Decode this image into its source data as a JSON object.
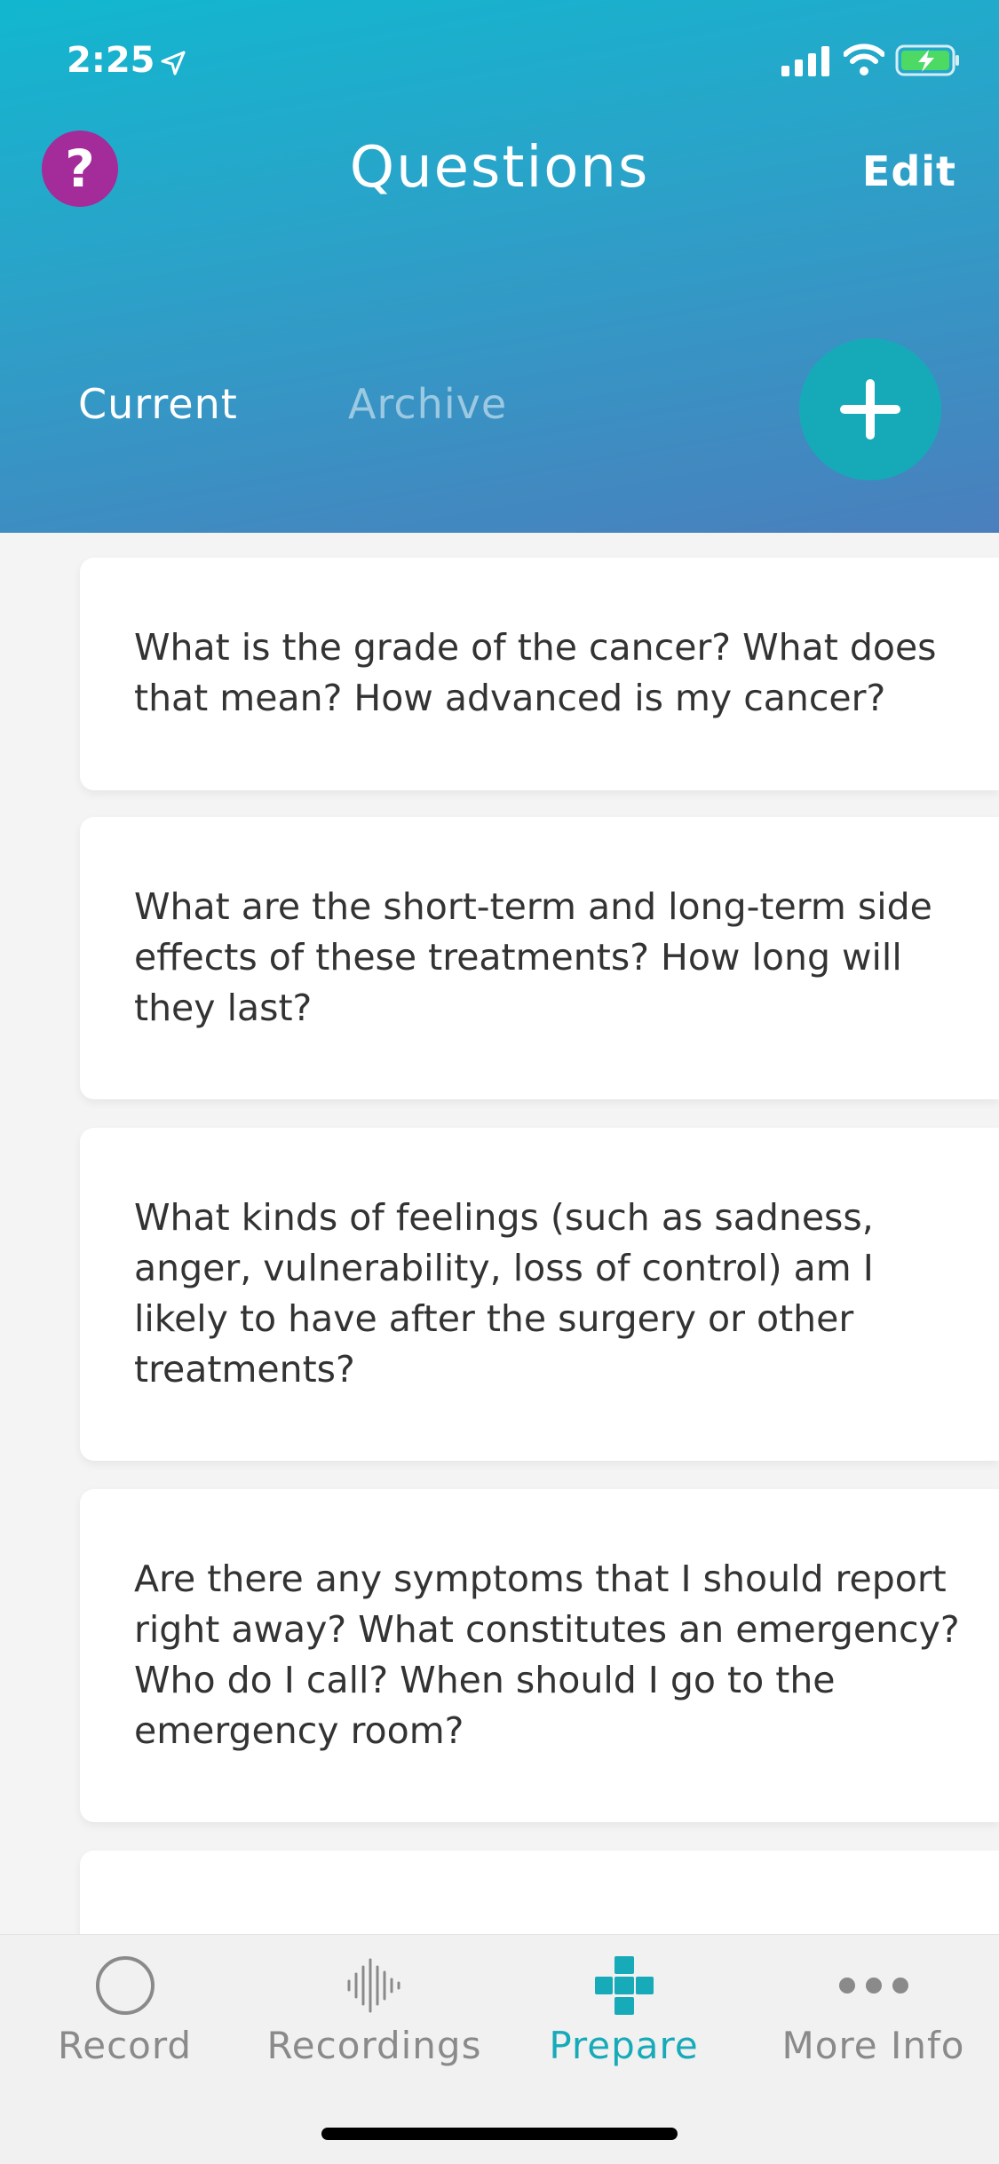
{
  "status_bar": {
    "time": "2:25"
  },
  "header": {
    "title": "Questions",
    "help_label": "?",
    "edit_label": "Edit",
    "tabs": [
      {
        "label": "Current",
        "active": true
      },
      {
        "label": "Archive",
        "active": false
      }
    ],
    "add_icon": "plus-icon"
  },
  "questions": [
    {
      "text": "What is the grade of the cancer? What does that mean? How advanced is my cancer?"
    },
    {
      "text": "What are the short-term and long-term side effects of these treatments? How long will they last?"
    },
    {
      "text": "What kinds of feelings (such as sadness, anger, vulnerability, loss of control) am I likely to have after the surgery or other treatments?"
    },
    {
      "text": "Are there any symptoms that I should report right away? What constitutes an emergency? Who do I call? When should I go to the emergency room?"
    }
  ],
  "bottom_nav": [
    {
      "label": "Record",
      "icon": "circle-icon",
      "active": false
    },
    {
      "label": "Recordings",
      "icon": "waveform-icon",
      "active": false
    },
    {
      "label": "Prepare",
      "icon": "cross-icon",
      "active": true
    },
    {
      "label": "More Info",
      "icon": "ellipsis-icon",
      "active": false
    }
  ],
  "colors": {
    "accent": "#17aab8",
    "help_button": "#a42b9a",
    "header_top": "#12b7cf",
    "header_bottom": "#4a7fbd"
  }
}
